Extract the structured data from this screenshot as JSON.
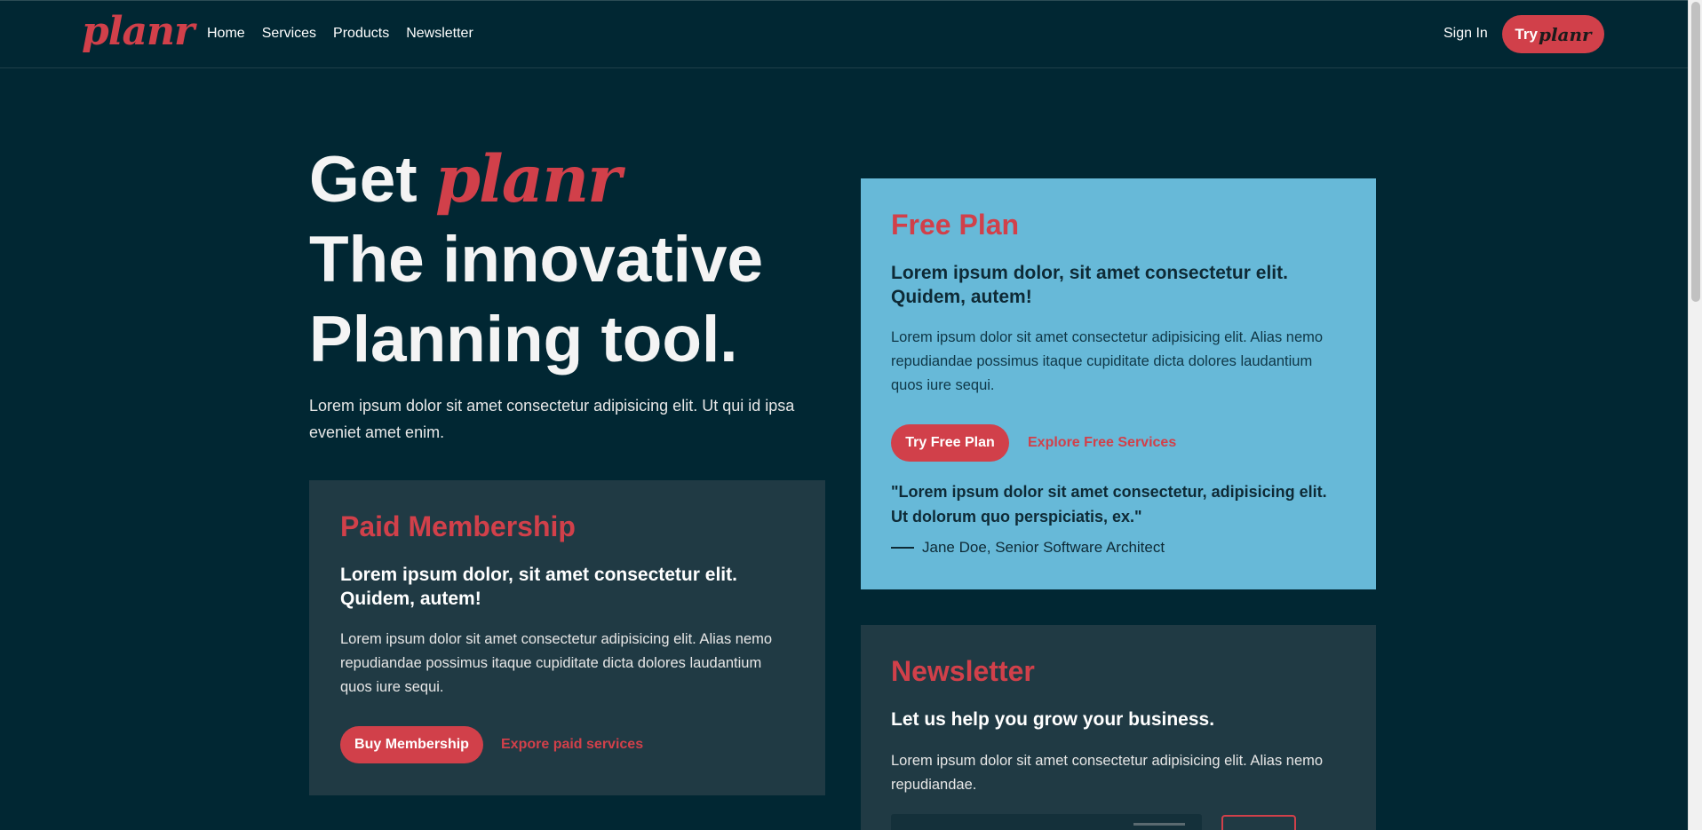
{
  "header": {
    "logo": "planr",
    "nav": [
      "Home",
      "Services",
      "Products",
      "Newsletter"
    ],
    "signin": "Sign In",
    "try_prefix": "Try",
    "try_brand": "planr"
  },
  "hero": {
    "title_get": "Get",
    "title_brand": "planr",
    "title_line2": "The innovative",
    "title_line3": "Planning tool.",
    "subtitle": "Lorem ipsum dolor sit amet consectetur adipisicing elit. Ut qui id ipsa eveniet amet enim."
  },
  "paid": {
    "heading": "Paid Membership",
    "subheading": "Lorem ipsum dolor, sit amet consectetur elit. Quidem, autem!",
    "body": "Lorem ipsum dolor sit amet consectetur adipisicing elit. Alias nemo repudiandae possimus itaque cupiditate dicta dolores laudantium quos iure sequi.",
    "button": "Buy Membership",
    "link": "Expore paid services"
  },
  "free": {
    "heading": "Free Plan",
    "subheading": "Lorem ipsum dolor, sit amet consectetur elit. Quidem, autem!",
    "body": "Lorem ipsum dolor sit amet consectetur adipisicing elit. Alias nemo repudiandae possimus itaque cupiditate dicta dolores laudantium quos iure sequi.",
    "button": "Try Free Plan",
    "link": "Explore Free Services",
    "quote": "\"Lorem ipsum dolor sit amet consectetur, adipisicing elit. Ut dolorum quo perspiciatis, ex.\"",
    "author": "Jane Doe, Senior Software Architect"
  },
  "newsletter": {
    "heading": "Newsletter",
    "subheading": "Let us help you grow your business.",
    "body": "Lorem ipsum dolor sit amet consectetur adipisicing elit. Alias nemo repudiandae."
  },
  "colors": {
    "background": "#012733",
    "accent": "#d1404a",
    "card_dark": "#203a44",
    "card_light": "#67b9d8"
  }
}
